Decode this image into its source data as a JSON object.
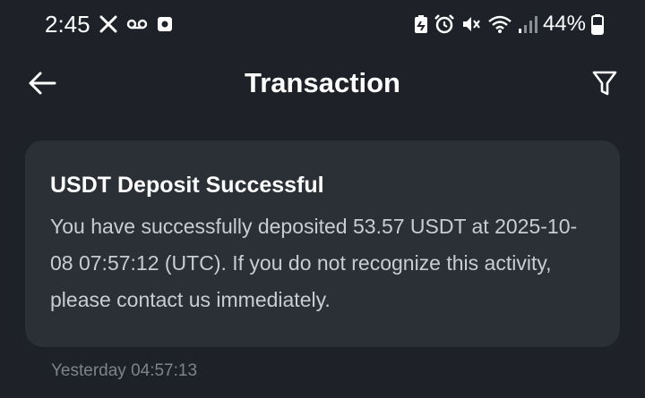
{
  "status_bar": {
    "time": "2:45",
    "battery_percent": "44%",
    "icons_left": [
      "x-logo-icon",
      "voicemail-icon",
      "notification-app-icon"
    ],
    "icons_right": [
      "battery-saver-icon",
      "alarm-icon",
      "mute-icon",
      "wifi-icon",
      "signal-icon",
      "battery-icon"
    ]
  },
  "header": {
    "title": "Transaction",
    "back_icon": "arrow-left-icon",
    "filter_icon": "filter-icon"
  },
  "notification": {
    "title": "USDT Deposit Successful",
    "message": "You have successfully deposited 53.57 USDT at 2025-10-08 07:57:12 (UTC). If you do not recognize this activity, please contact us immediately.",
    "timestamp": "Yesterday 04:57:13"
  },
  "colors": {
    "background": "#1e2228",
    "card": "#2b2f36",
    "body_text": "#c9cdd3",
    "muted_text": "#7d838c"
  }
}
